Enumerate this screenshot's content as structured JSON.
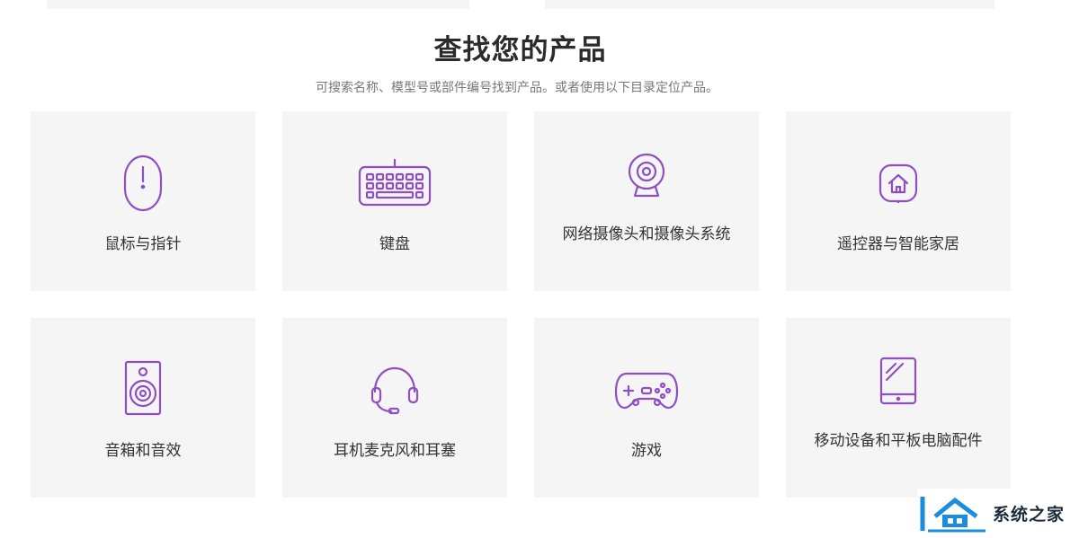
{
  "section": {
    "title": "查找您的产品",
    "subtitle": "可搜索名称、模型号或部件编号找到产品。或者使用以下目录定位产品。"
  },
  "categories": [
    {
      "label": "鼠标与指针",
      "icon": "mouse-icon"
    },
    {
      "label": "键盘",
      "icon": "keyboard-icon"
    },
    {
      "label": "网络摄像头和摄像头系统",
      "icon": "webcam-icon"
    },
    {
      "label": "遥控器与智能家居",
      "icon": "smart-home-icon"
    },
    {
      "label": "音箱和音效",
      "icon": "speaker-icon"
    },
    {
      "label": "耳机麦克风和耳塞",
      "icon": "headset-icon"
    },
    {
      "label": "游戏",
      "icon": "gamepad-icon"
    },
    {
      "label": "移动设备和平板电脑配件",
      "icon": "tablet-icon"
    }
  ],
  "watermark": {
    "text": "系统之家"
  },
  "colors": {
    "accent": "#8e4fc4",
    "tile_bg": "#f5f5f5",
    "watermark_blue": "#1a8de0"
  }
}
